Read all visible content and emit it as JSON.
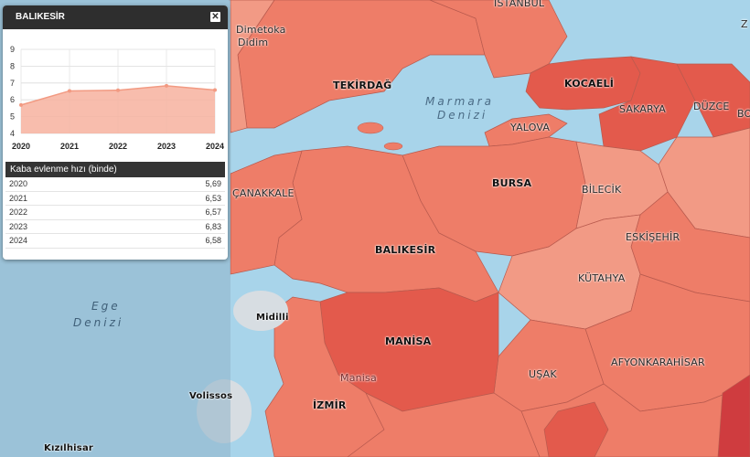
{
  "panel": {
    "title": "BALIKESİR",
    "close_icon": "close-icon",
    "table_header": "Kaba evlenme hızı (binde)",
    "rows": [
      {
        "year": "2020",
        "value": "5,69"
      },
      {
        "year": "2021",
        "value": "6,53"
      },
      {
        "year": "2022",
        "value": "6,57"
      },
      {
        "year": "2023",
        "value": "6,83"
      },
      {
        "year": "2024",
        "value": "6,58"
      }
    ]
  },
  "chart_data": {
    "type": "area",
    "x": [
      "2020",
      "2021",
      "2022",
      "2023",
      "2024"
    ],
    "values": [
      5.69,
      6.53,
      6.57,
      6.83,
      6.58
    ],
    "y_ticks": [
      "4",
      "5",
      "6",
      "7",
      "8",
      "9"
    ],
    "ylim": [
      4,
      9
    ],
    "grid": true,
    "fill_color": "#f7b19f",
    "line_color": "#f29a82"
  },
  "map": {
    "provinces": {
      "balikesir": "BALIKESİR",
      "bursa": "BURSA",
      "manisa": "MANİSA",
      "kocaeli": "KOCAELİ",
      "sakarya": "SAKARYA",
      "duzce": "DÜZCE",
      "tekirdag": "TEKİRDAĞ",
      "yalova": "YALOVA",
      "bilecik": "BİLECİK",
      "eskisehir": "ESKİŞEHİR",
      "kutahya": "KÜTAHYA",
      "usak": "UŞAK",
      "afyon": "AFYONKARAHİSAR",
      "izmir": "İZMİR",
      "canakkale": "ÇANAKKALE",
      "istanbul": "İSTANBUL"
    },
    "seas": {
      "marmara_1": "Marmara",
      "marmara_2": "Denizi",
      "ege_1": "Ege",
      "ege_2": "Denizi"
    },
    "places": {
      "dimetoka": "Dimetoka",
      "didim": "Didim",
      "midilli": "Midilli",
      "volissos": "Volissos",
      "kizilhisar": "Kızılhisar",
      "manisa_town": "Manisa",
      "z": "Z",
      "bo": "BO"
    },
    "colors": {
      "sea": "#a8d4ea",
      "light": "#f29a85",
      "medium": "#ee7d68",
      "dark": "#e35a4c",
      "darkest": "#cf3c3f"
    }
  }
}
